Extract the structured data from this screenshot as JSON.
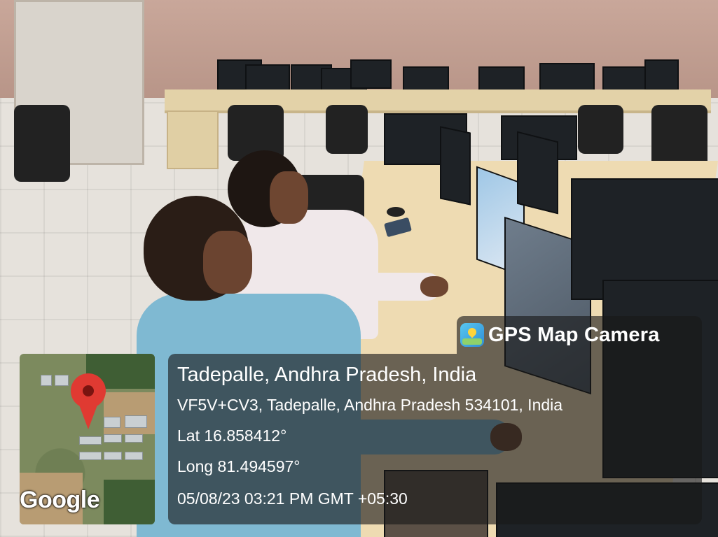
{
  "overlay": {
    "app_name": "GPS Map Camera",
    "app_icon": "gps-map-camera-icon",
    "location_title": "Tadepalle, Andhra Pradesh, India",
    "address": "VF5V+CV3, Tadepalle, Andhra Pradesh 534101, India",
    "latitude": "Lat 16.858412°",
    "longitude": "Long 81.494597°",
    "timestamp": "05/08/23 03:21 PM GMT +05:30",
    "map_attribution": "Google",
    "pin_icon": "map-pin-icon"
  },
  "colors": {
    "overlay_bg": "#191919",
    "pin": "#e03a32",
    "text": "#ffffff"
  }
}
